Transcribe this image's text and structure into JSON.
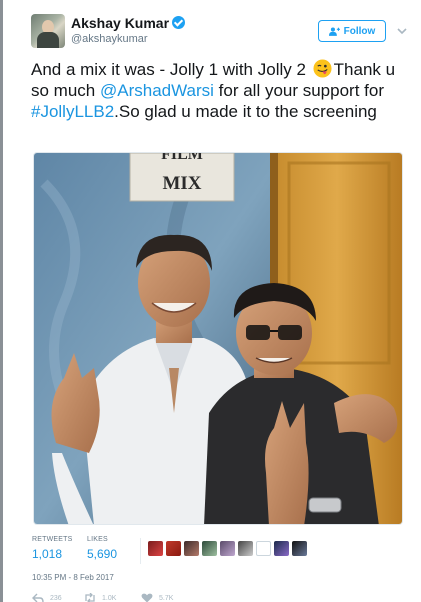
{
  "tweet": {
    "author_name": "Akshay Kumar",
    "author_handle": "@akshaykumar",
    "verified": true,
    "follow_label": "Follow",
    "text_part1": "And a mix it was - Jolly 1 with Jolly 2 ",
    "text_part2": "Thank u so much ",
    "mention": "@ArshadWarsi",
    "text_part3": " for all your support for ",
    "hashtag": "#JollyLLB2",
    "text_part4": ".So glad u made it to the screening",
    "emoji": "winking-face-with-tongue",
    "sign_text": "FILM MIX"
  },
  "stats": {
    "retweets_label": "RETWEETS",
    "retweets_value": "1,018",
    "likes_label": "LIKES",
    "likes_value": "5,690"
  },
  "timestamp": "10:35 PM - 8 Feb 2017",
  "actions": {
    "reply_count": "236",
    "retweet_count": "1.0K",
    "like_count": "5.7K"
  },
  "colors": {
    "link": "#1b95e0",
    "follow": "#1da1f2",
    "muted": "#657786"
  }
}
